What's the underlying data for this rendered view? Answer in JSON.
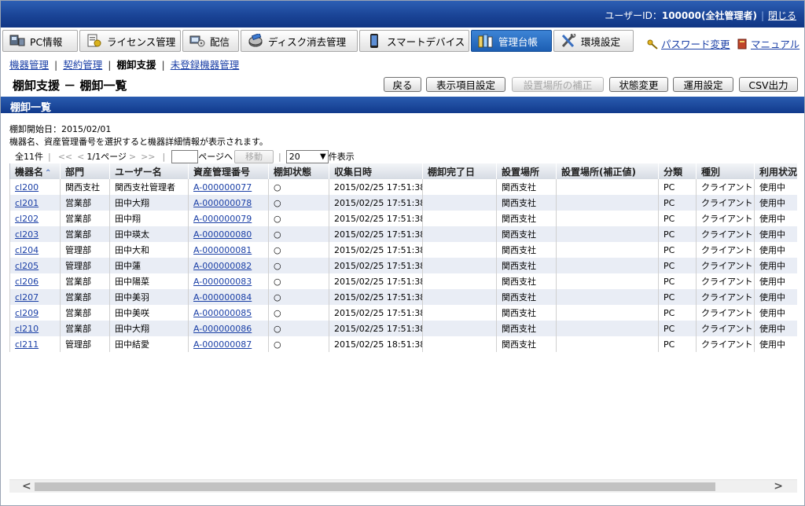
{
  "header": {
    "user_label": "ユーザーID：",
    "user_value": "100000(全社管理者)",
    "logout": "閉じる"
  },
  "nav": {
    "tabs": [
      {
        "label": "PC情報",
        "icon": "pc-icon"
      },
      {
        "label": "ライセンス管理",
        "icon": "license-icon"
      },
      {
        "label": "配信",
        "icon": "distribution-icon"
      },
      {
        "label": "ディスク消去管理",
        "icon": "disk-erase-icon"
      },
      {
        "label": "スマートデバイス",
        "icon": "smart-device-icon"
      },
      {
        "label": "管理台帳",
        "icon": "ledger-icon",
        "active": true
      },
      {
        "label": "環境設定",
        "icon": "settings-tools-icon"
      }
    ],
    "password_link": "パスワード変更",
    "manual_link": "マニュアル"
  },
  "subnav": {
    "items": [
      "機器管理",
      "契約管理",
      "棚卸支援",
      "未登録機器管理"
    ],
    "current": "棚卸支援"
  },
  "page": {
    "title": "棚卸支援 － 棚卸一覧",
    "buttons": {
      "back": "戻る",
      "display_items": "表示項目設定",
      "location_fix": "設置場所の補正",
      "status_change": "状態変更",
      "operation_settings": "運用設定",
      "csv": "CSV出力"
    },
    "section_title": "棚卸一覧",
    "start_date": "棚卸開始日：2015/02/01",
    "hint": "機器名、資産管理番号を選択すると機器詳細情報が表示されます。"
  },
  "pager": {
    "total": "全11件",
    "page_info": "1/1ページ",
    "goto_suffix": "ページへ",
    "move": "移動",
    "per_page": "20",
    "per_page_suffix": "件表示",
    "first": "<<",
    "prev": "<",
    "next": ">",
    "last": ">>"
  },
  "table": {
    "columns": [
      "機器名",
      "部門",
      "ユーザー名",
      "資産管理番号",
      "棚卸状態",
      "収集日時",
      "棚卸完了日",
      "設置場所",
      "設置場所(補正値)",
      "分類",
      "種別",
      "利用状況"
    ],
    "rows": [
      [
        "cl200",
        "関西支社",
        "関西支社管理者",
        "A-000000077",
        "○",
        "2015/02/25 17:51:38",
        "",
        "関西支社",
        "",
        "PC",
        "クライアント",
        "使用中"
      ],
      [
        "cl201",
        "営業部",
        "田中大翔",
        "A-000000078",
        "○",
        "2015/02/25 17:51:38",
        "",
        "関西支社",
        "",
        "PC",
        "クライアント",
        "使用中"
      ],
      [
        "cl202",
        "営業部",
        "田中翔",
        "A-000000079",
        "○",
        "2015/02/25 17:51:38",
        "",
        "関西支社",
        "",
        "PC",
        "クライアント",
        "使用中"
      ],
      [
        "cl203",
        "営業部",
        "田中瑛太",
        "A-000000080",
        "○",
        "2015/02/25 17:51:38",
        "",
        "関西支社",
        "",
        "PC",
        "クライアント",
        "使用中"
      ],
      [
        "cl204",
        "管理部",
        "田中大和",
        "A-000000081",
        "○",
        "2015/02/25 17:51:38",
        "",
        "関西支社",
        "",
        "PC",
        "クライアント",
        "使用中"
      ],
      [
        "cl205",
        "管理部",
        "田中蓮",
        "A-000000082",
        "○",
        "2015/02/25 17:51:38",
        "",
        "関西支社",
        "",
        "PC",
        "クライアント",
        "使用中"
      ],
      [
        "cl206",
        "営業部",
        "田中陽菜",
        "A-000000083",
        "○",
        "2015/02/25 17:51:38",
        "",
        "関西支社",
        "",
        "PC",
        "クライアント",
        "使用中"
      ],
      [
        "cl207",
        "営業部",
        "田中美羽",
        "A-000000084",
        "○",
        "2015/02/25 17:51:38",
        "",
        "関西支社",
        "",
        "PC",
        "クライアント",
        "使用中"
      ],
      [
        "cl209",
        "営業部",
        "田中美咲",
        "A-000000085",
        "○",
        "2015/02/25 17:51:38",
        "",
        "関西支社",
        "",
        "PC",
        "クライアント",
        "使用中"
      ],
      [
        "cl210",
        "営業部",
        "田中大翔",
        "A-000000086",
        "○",
        "2015/02/25 17:51:38",
        "",
        "関西支社",
        "",
        "PC",
        "クライアント",
        "使用中"
      ],
      [
        "cl211",
        "管理部",
        "田中結愛",
        "A-000000087",
        "○",
        "2015/02/25 18:51:38",
        "",
        "関西支社",
        "",
        "PC",
        "クライアント",
        "使用中"
      ]
    ]
  },
  "colors": {
    "header_blue": "#1a4496",
    "active_tab": "#2a6fc4",
    "link": "#1a3fa6",
    "row_alt": "#e9edf5"
  }
}
